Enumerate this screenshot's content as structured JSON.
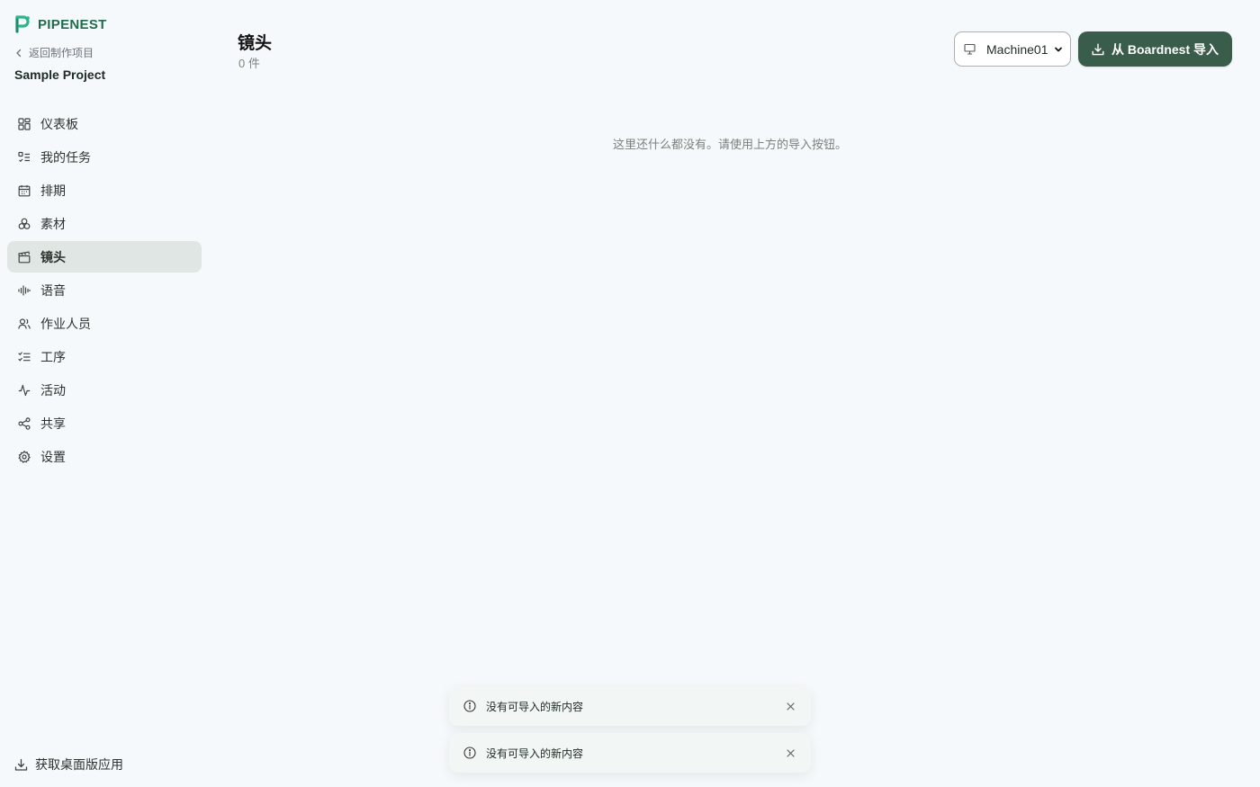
{
  "brand": {
    "name": "PIPENEST",
    "accent": "#1f6b4c"
  },
  "sidebar": {
    "back_label": "返回制作项目",
    "project_name": "Sample Project",
    "items": [
      {
        "label": "仪表板",
        "icon": "dashboard-icon"
      },
      {
        "label": "我的任务",
        "icon": "task-list-icon"
      },
      {
        "label": "排期",
        "icon": "calendar-icon"
      },
      {
        "label": "素材",
        "icon": "assets-icon"
      },
      {
        "label": "镜头",
        "icon": "clapperboard-icon",
        "active": true
      },
      {
        "label": "语音",
        "icon": "audio-wave-icon"
      },
      {
        "label": "作业人员",
        "icon": "users-icon"
      },
      {
        "label": "工序",
        "icon": "checklist-icon"
      },
      {
        "label": "活动",
        "icon": "activity-icon"
      },
      {
        "label": "共享",
        "icon": "share-icon"
      },
      {
        "label": "设置",
        "icon": "gear-icon"
      }
    ],
    "desktop_app_label": "获取桌面版应用"
  },
  "header": {
    "title": "镜头",
    "count": "0 件",
    "machine_select": {
      "value": "Machine01"
    },
    "import_button": {
      "label": "从 Boardnest 导入",
      "color": "#3a5d4b"
    }
  },
  "main": {
    "empty_message": "这里还什么都没有。请使用上方的导入按钮。"
  },
  "toasts": [
    {
      "message": "没有可导入的新内容"
    },
    {
      "message": "没有可导入的新内容"
    }
  ]
}
